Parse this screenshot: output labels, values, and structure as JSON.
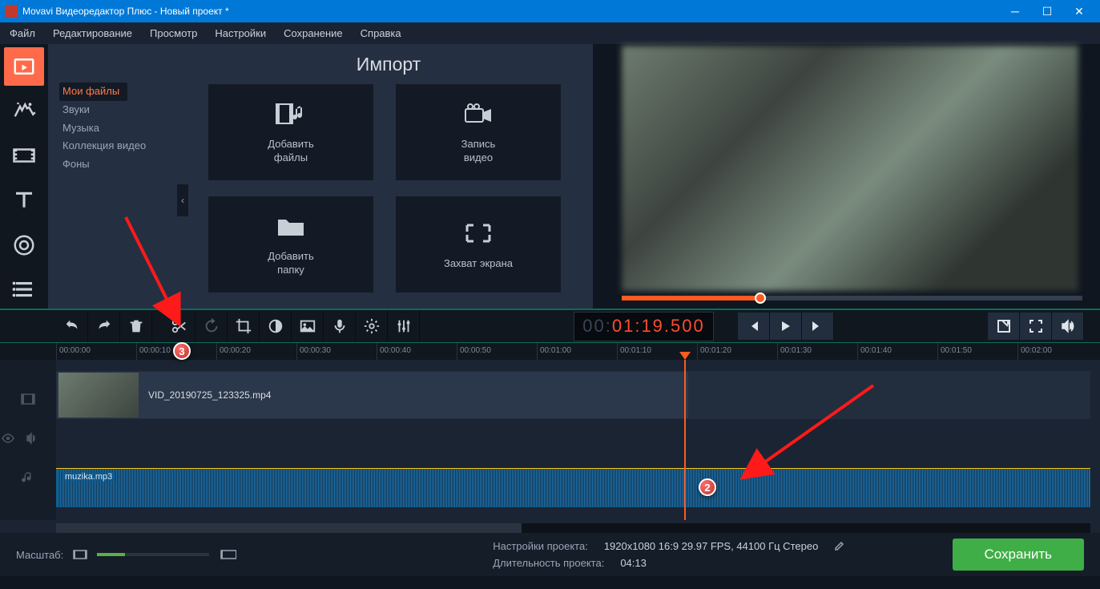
{
  "titlebar": {
    "title": "Movavi Видеоредактор Плюс - Новый проект *"
  },
  "menubar": [
    "Файл",
    "Редактирование",
    "Просмотр",
    "Настройки",
    "Сохранение",
    "Справка"
  ],
  "import": {
    "title": "Импорт",
    "cats": [
      "Мои файлы",
      "Звуки",
      "Музыка",
      "Коллекция видео",
      "Фоны"
    ],
    "tiles": {
      "add_files": "Добавить\nфайлы",
      "record_video": "Запись\nвидео",
      "add_folder": "Добавить\nпапку",
      "screen_capture": "Захват экрана"
    }
  },
  "playback": {
    "time_gray": "00:",
    "time_lit": "01:19.500"
  },
  "ruler": [
    "00:00:00",
    "00:00:10",
    "00:00:20",
    "00:00:30",
    "00:00:40",
    "00:00:50",
    "00:01:00",
    "00:01:10",
    "00:01:20",
    "00:01:30",
    "00:01:40",
    "00:01:50",
    "00:02:00"
  ],
  "clips": {
    "video": "VID_20190725_123325.mp4",
    "audio": "muzika.mp3"
  },
  "status": {
    "zoom_label": "Масштаб:",
    "proj_settings_label": "Настройки проекта:",
    "proj_settings_value": "1920x1080 16:9 29.97 FPS, 44100 Гц Стерео",
    "duration_label": "Длительность проекта:",
    "duration_value": "04:13",
    "save": "Сохранить"
  },
  "badges": {
    "b2": "2",
    "b3": "3"
  }
}
